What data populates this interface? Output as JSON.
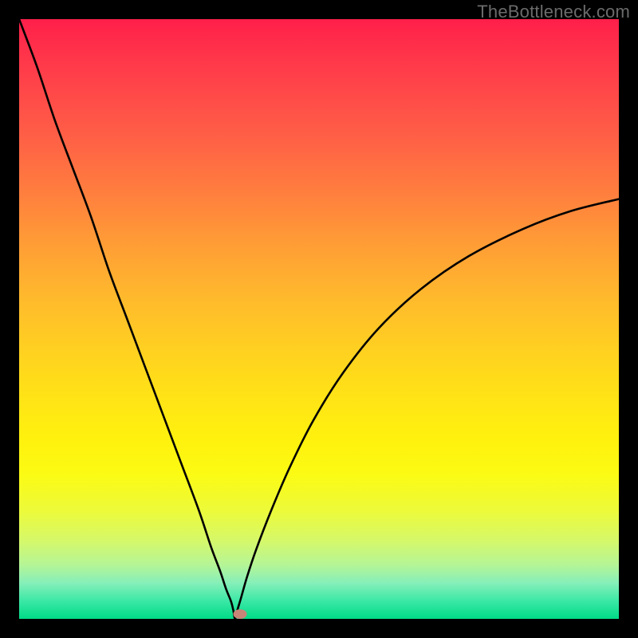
{
  "watermark": "TheBottleneck.com",
  "colors": {
    "frame_bg": "#000000",
    "curve": "#000000",
    "marker": "#c78577",
    "gradient_top": "#ff1f4a",
    "gradient_bottom": "#00db86"
  },
  "chart_data": {
    "type": "line",
    "title": "",
    "xlabel": "",
    "ylabel": "",
    "x_range": [
      0,
      100
    ],
    "y_range": [
      0,
      100
    ],
    "min_point_x": 36,
    "series": [
      {
        "name": "bottleneck-curve",
        "x": [
          0,
          3,
          6,
          9,
          12,
          15,
          18,
          21,
          24,
          27,
          30,
          32,
          33.5,
          34.5,
          35.3,
          35.7,
          36,
          36.4,
          37,
          38,
          39.5,
          42,
          45,
          49,
          54,
          60,
          67,
          75,
          84,
          92,
          100
        ],
        "y": [
          100,
          92,
          83,
          75,
          67,
          58,
          50,
          42,
          34,
          26,
          18,
          12,
          8,
          5,
          3,
          1.5,
          0,
          1.5,
          3.5,
          7,
          11.5,
          18,
          25,
          33,
          41,
          48.5,
          55,
          60.5,
          65,
          68,
          70
        ]
      }
    ],
    "marker": {
      "x": 36.8,
      "y": 0.8
    }
  }
}
